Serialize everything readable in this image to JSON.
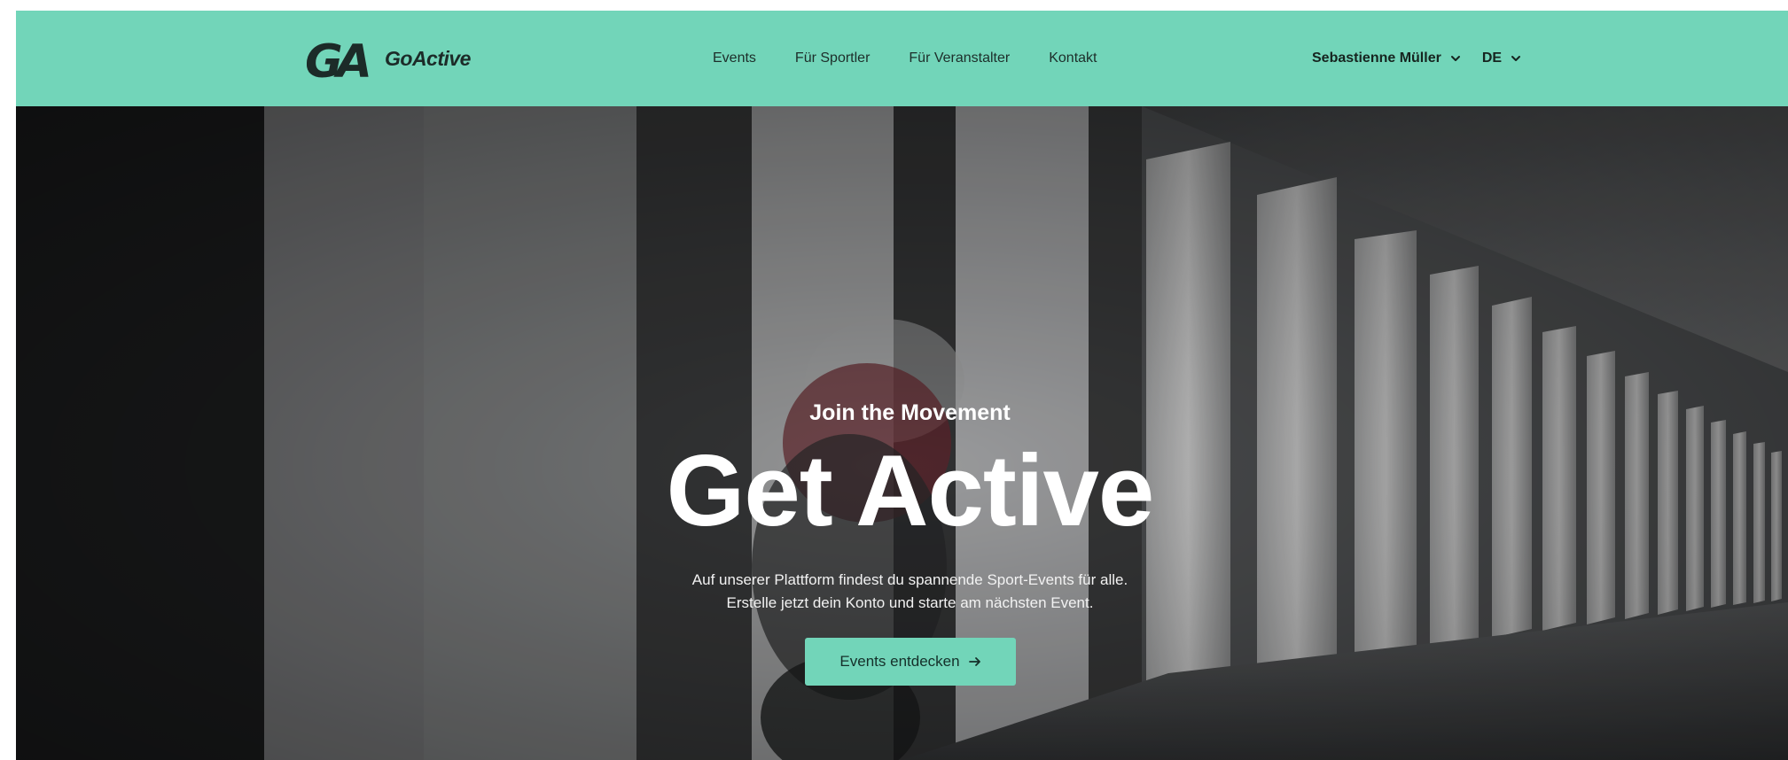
{
  "brand": {
    "mark": "GA",
    "name": "GoActive",
    "accent_color": "#72d5b9"
  },
  "nav": {
    "items": [
      {
        "label": "Events"
      },
      {
        "label": "Für Sportler"
      },
      {
        "label": "Für Veranstalter"
      },
      {
        "label": "Kontakt"
      }
    ]
  },
  "user": {
    "name": "Sebastienne Müller",
    "language": "DE",
    "dropdown_icon": "chevron-down-icon"
  },
  "hero": {
    "eyebrow": "Join the Movement",
    "title": "Get Active",
    "text_line1": "Auf unserer Plattform findest du spannende Sport-Events für alle.",
    "text_line2": "Erstelle jetzt dein Konto und starte am nächsten Event.",
    "cta_label": "Events entdecken",
    "cta_icon": "arrow-right-icon"
  }
}
